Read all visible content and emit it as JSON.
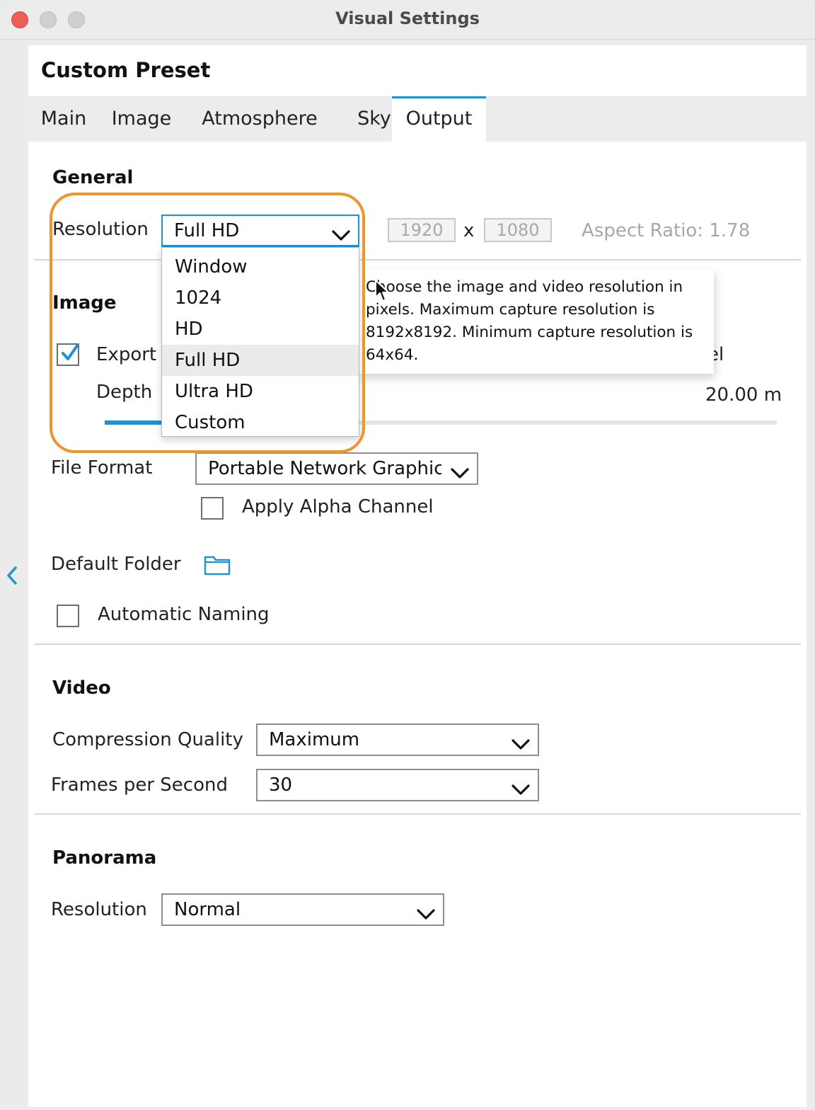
{
  "window": {
    "title": "Visual Settings",
    "controls": [
      "close",
      "minimize",
      "zoom"
    ]
  },
  "panel": {
    "preset_title": "Custom Preset",
    "tabs": [
      {
        "label": "Main"
      },
      {
        "label": "Image"
      },
      {
        "label": "Atmosphere"
      },
      {
        "label": "Sky"
      },
      {
        "label": "Output",
        "active": true
      }
    ]
  },
  "general": {
    "heading": "General",
    "resolution_label": "Resolution",
    "resolution_value": "Full HD",
    "width": "1920",
    "x_sep": "x",
    "height": "1080",
    "aspect_ratio": "Aspect Ratio: 1.78",
    "dropdown_options": [
      "Window",
      "1024",
      "HD",
      "Full HD",
      "Ultra HD",
      "Custom"
    ],
    "dropdown_selected_index": 3,
    "tooltip": "Choose the image and video resolution in pixels. Maximum capture resolution is 8192x8192. Minimum capture resolution is 64x64."
  },
  "image": {
    "heading": "Image",
    "export_label": "Export",
    "export_checked": true,
    "export_trailing_text": "el",
    "depth_label": "Depth",
    "depth_value": "20.00 m",
    "file_format_label": "File Format",
    "file_format_value": "Portable Network Graphic",
    "alpha_label": "Apply Alpha Channel",
    "alpha_checked": false,
    "default_folder_label": "Default Folder",
    "auto_naming_label": "Automatic Naming",
    "auto_naming_checked": false
  },
  "video": {
    "heading": "Video",
    "compression_label": "Compression Quality",
    "compression_value": "Maximum",
    "fps_label": "Frames per Second",
    "fps_value": "30"
  },
  "panorama": {
    "heading": "Panorama",
    "resolution_label": "Resolution",
    "resolution_value": "Normal"
  },
  "colors": {
    "accent": "#1b93d6",
    "highlight": "#f0952a",
    "close": "#ec5f57"
  },
  "icons": {
    "sidebar_toggle": "chevron-left-icon",
    "folder": "folder-icon",
    "dropdown": "chevron-down-icon",
    "check": "checkmark-icon",
    "cursor": "mouse-pointer-icon"
  }
}
